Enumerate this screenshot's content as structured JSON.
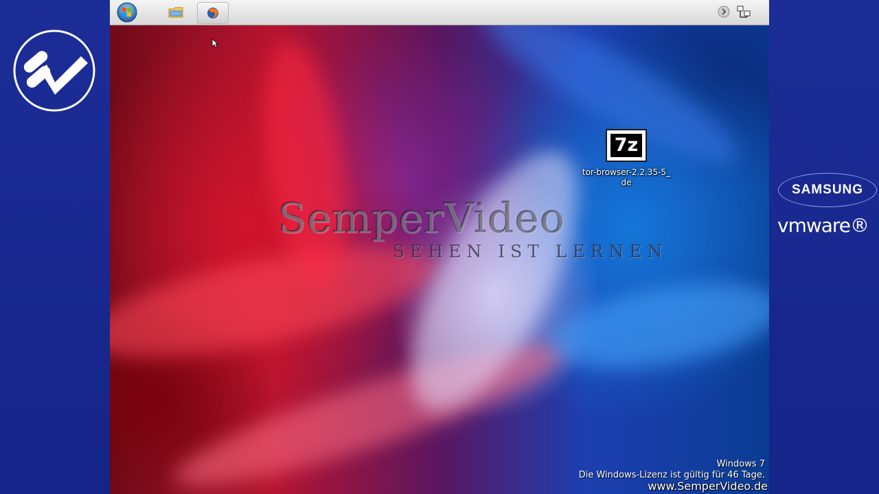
{
  "side_branding": {
    "samsung_label": "SAMSUNG",
    "vmware_label": "vmware®"
  },
  "taskbar": {
    "start_icon": "windows-orb-icon",
    "pinned": [
      {
        "name": "explorer",
        "icon": "folder-icon"
      },
      {
        "name": "firefox",
        "icon": "firefox-icon",
        "active": true
      }
    ],
    "tray_icons": [
      "show-hidden-icons-chevron",
      "network-icon"
    ]
  },
  "desktop": {
    "icons": [
      {
        "label": "tor-browser-2.2.35-5_de",
        "label_line1": "tor-browser-2.2.35-5_",
        "label_line2": "de",
        "badge": "7z"
      }
    ],
    "wallpaper_title": "SemperVideo",
    "wallpaper_subtitle": "SEHEN IST LERNEN",
    "os_name": "Windows 7",
    "license_notice": "Die Windows-Lizenz ist gültig für 46 Tage.",
    "site_url": "www.SemperVideo.de"
  },
  "colors": {
    "frame_blue": "#1a2a8f",
    "taskbar": "#e3e3e3",
    "wallpaper_red": "#d0142c",
    "wallpaper_blue": "#1477d8"
  }
}
